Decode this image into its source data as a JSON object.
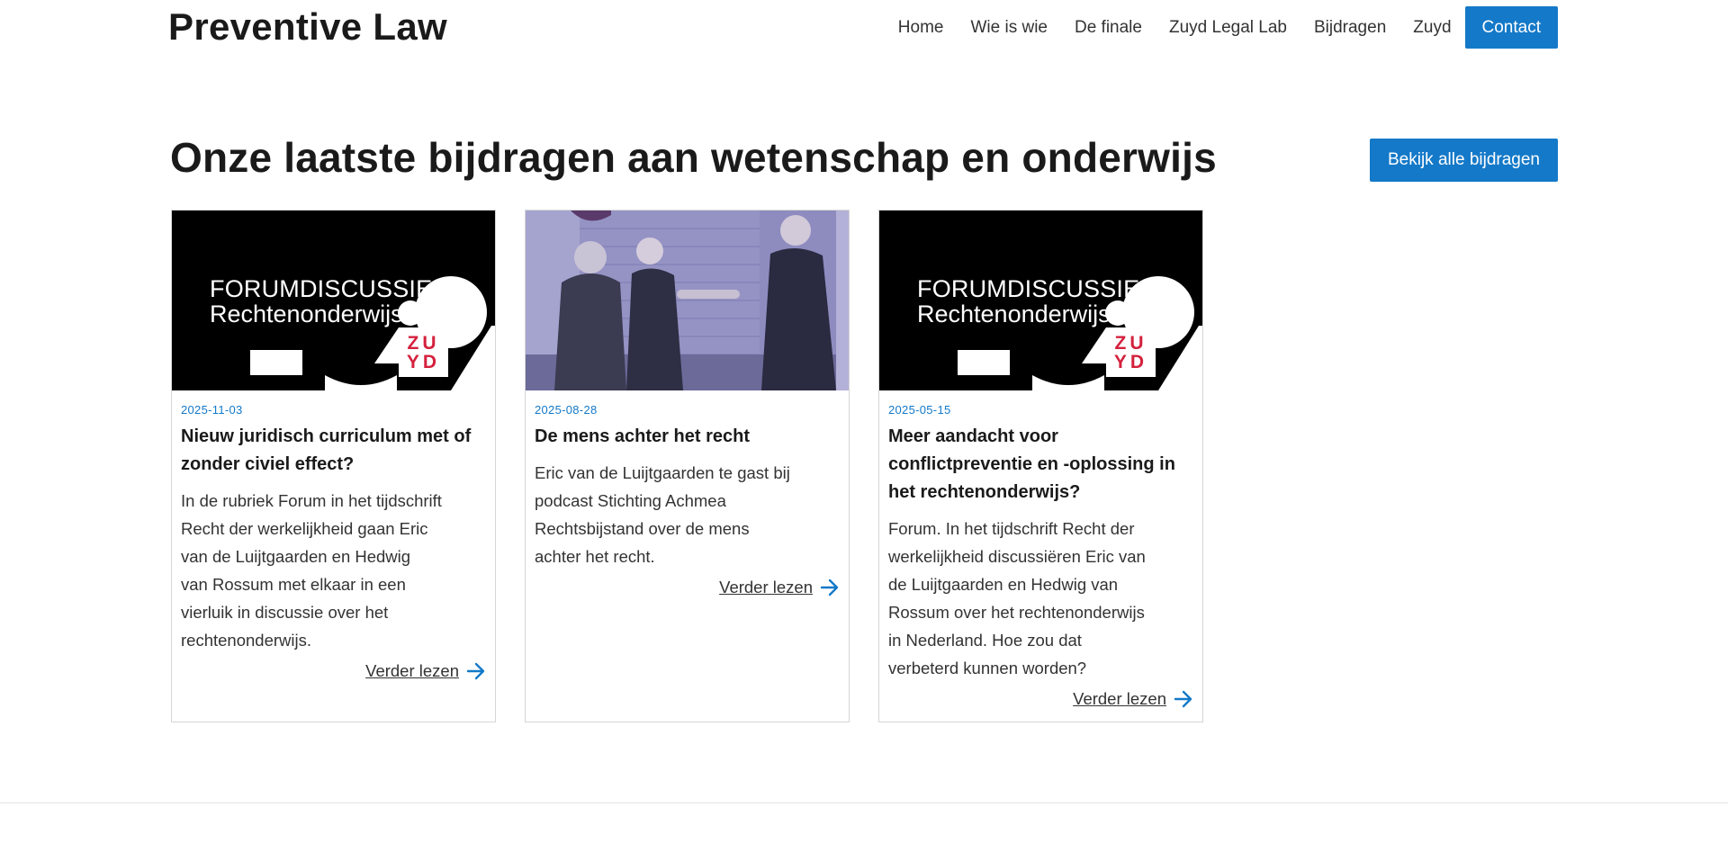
{
  "site": {
    "title": "Preventive Law"
  },
  "nav": {
    "items": [
      "Home",
      "Wie is wie",
      "De finale",
      "Zuyd Legal Lab",
      "Bijdragen",
      "Zuyd"
    ],
    "contact": "Contact"
  },
  "section": {
    "title": "Onze laatste bijdragen aan wetenschap en onderwijs",
    "all_button": "Bekijk alle bijdragen"
  },
  "cards": [
    {
      "date": "2025-11-03",
      "title": "Nieuw juridisch curriculum met of zonder civiel effect?",
      "text": "In de rubriek Forum in het tijdschrift Recht der werkelijkheid gaan Eric van de Luijtgaarden en Hedwig van Rossum met elkaar in een vierluik in discussie over het rechtenonderwijs.",
      "more": "Verder lezen",
      "image": {
        "line1": "FORUMDISCUSSIE",
        "line2": "Rechtenonderwijs",
        "logo": [
          "ZU",
          "YD"
        ]
      }
    },
    {
      "date": "2025-08-28",
      "title": "De mens achter het recht",
      "text": "Eric van de Luijtgaarden te gast bij podcast Stichting Achmea Rechtsbijstand over de mens achter het recht.",
      "more": "Verder lezen"
    },
    {
      "date": "2025-05-15",
      "title": "Meer aandacht voor conflictpreventie en -oplossing in het rechtenonderwijs?",
      "text": "Forum. In het tijdschrift Recht der werkelijkheid discussiëren Eric van de Luijtgaarden en Hedwig van Rossum over het rechtenonderwijs in Nederland. Hoe zou dat verbeterd kunnen worden?",
      "more": "Verder lezen",
      "image": {
        "line1": "FORUMDISCUSSIE",
        "line2": "Rechtenonderwijs",
        "logo": [
          "ZU",
          "YD"
        ]
      }
    }
  ],
  "colors": {
    "accent": "#1479c8",
    "zuyd_red": "#d4213d"
  }
}
